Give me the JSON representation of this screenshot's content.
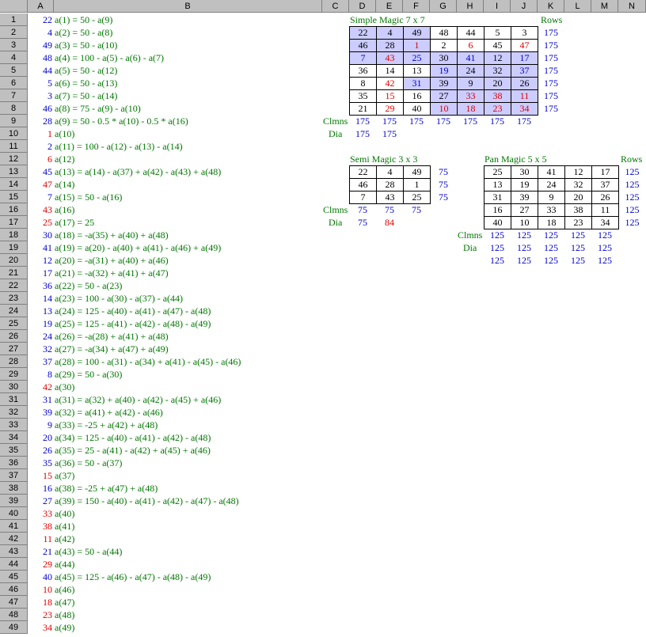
{
  "colors": {
    "blue": "#0000cc",
    "red": "#dd0000",
    "green": "#007700",
    "black": "#000000",
    "shade": "#ccccff"
  },
  "columns": [
    "A",
    "B",
    "C",
    "D",
    "E",
    "F",
    "G",
    "H",
    "I",
    "J",
    "K",
    "L",
    "M",
    "N"
  ],
  "rows": [
    "1",
    "2",
    "3",
    "4",
    "5",
    "6",
    "7",
    "8",
    "9",
    "10",
    "11",
    "12",
    "13",
    "14",
    "15",
    "16",
    "17",
    "18",
    "19",
    "20",
    "21",
    "22",
    "23",
    "24",
    "25",
    "26",
    "27",
    "28",
    "29",
    "30",
    "31",
    "32",
    "33",
    "34",
    "35",
    "36",
    "37",
    "38",
    "39",
    "40",
    "41",
    "42",
    "43",
    "44",
    "45",
    "46",
    "47",
    "48",
    "49"
  ],
  "colA": [
    {
      "v": "22",
      "c": "blue"
    },
    {
      "v": "4",
      "c": "blue"
    },
    {
      "v": "49",
      "c": "blue"
    },
    {
      "v": "48",
      "c": "blue"
    },
    {
      "v": "44",
      "c": "blue"
    },
    {
      "v": "5",
      "c": "blue"
    },
    {
      "v": "3",
      "c": "blue"
    },
    {
      "v": "46",
      "c": "blue"
    },
    {
      "v": "28",
      "c": "blue"
    },
    {
      "v": "1",
      "c": "red"
    },
    {
      "v": "2",
      "c": "blue"
    },
    {
      "v": "6",
      "c": "red"
    },
    {
      "v": "45",
      "c": "blue"
    },
    {
      "v": "47",
      "c": "red"
    },
    {
      "v": "7",
      "c": "blue"
    },
    {
      "v": "43",
      "c": "red"
    },
    {
      "v": "25",
      "c": "red"
    },
    {
      "v": "30",
      "c": "blue"
    },
    {
      "v": "41",
      "c": "blue"
    },
    {
      "v": "12",
      "c": "blue"
    },
    {
      "v": "17",
      "c": "blue"
    },
    {
      "v": "36",
      "c": "blue"
    },
    {
      "v": "14",
      "c": "blue"
    },
    {
      "v": "13",
      "c": "blue"
    },
    {
      "v": "19",
      "c": "blue"
    },
    {
      "v": "24",
      "c": "blue"
    },
    {
      "v": "32",
      "c": "blue"
    },
    {
      "v": "37",
      "c": "blue"
    },
    {
      "v": "8",
      "c": "blue"
    },
    {
      "v": "42",
      "c": "red"
    },
    {
      "v": "31",
      "c": "blue"
    },
    {
      "v": "39",
      "c": "blue"
    },
    {
      "v": "9",
      "c": "blue"
    },
    {
      "v": "20",
      "c": "blue"
    },
    {
      "v": "26",
      "c": "blue"
    },
    {
      "v": "35",
      "c": "blue"
    },
    {
      "v": "15",
      "c": "red"
    },
    {
      "v": "16",
      "c": "blue"
    },
    {
      "v": "27",
      "c": "blue"
    },
    {
      "v": "33",
      "c": "red"
    },
    {
      "v": "38",
      "c": "red"
    },
    {
      "v": "11",
      "c": "red"
    },
    {
      "v": "21",
      "c": "blue"
    },
    {
      "v": "29",
      "c": "red"
    },
    {
      "v": "40",
      "c": "blue"
    },
    {
      "v": "10",
      "c": "red"
    },
    {
      "v": "18",
      "c": "red"
    },
    {
      "v": "23",
      "c": "red"
    },
    {
      "v": "34",
      "c": "red"
    }
  ],
  "colB": [
    "a(1) = 50 - a(9)",
    "a(2) = 50 - a(8)",
    "a(3) = 50 - a(10)",
    "a(4) = 100 - a(5) - a(6) - a(7)",
    "a(5) = 50 - a(12)",
    "a(6) = 50 - a(13)",
    "a(7) = 50 - a(14)",
    "a(8) = 75 - a(9) - a(10)",
    "a(9) = 50 - 0.5 * a(10) - 0.5 * a(16)",
    "a(10)",
    "a(11) = 100 - a(12) - a(13) - a(14)",
    "a(12)",
    "a(13) = a(14) - a(37) + a(42) - a(43) + a(48)",
    "a(14)",
    "a(15) = 50 - a(16)",
    "a(16)",
    "a(17) = 25",
    "a(18) = -a(35) + a(40) + a(48)",
    "a(19) = a(20) - a(40) + a(41) - a(46) + a(49)",
    "a(20) = -a(31) + a(40) + a(46)",
    "a(21) = -a(32) + a(41) + a(47)",
    "a(22) = 50 - a(23)",
    "a(23) = 100 - a(30) - a(37) - a(44)",
    "a(24) = 125 - a(40) - a(41) - a(47) - a(48)",
    "a(25) = 125 - a(41) - a(42) - a(48) - a(49)",
    "a(26) = -a(28) + a(41) + a(48)",
    "a(27) = -a(34) + a(47) + a(49)",
    "a(28) = 100 - a(31) - a(34) + a(41) - a(45) - a(46)",
    "a(29) = 50 - a(30)",
    "a(30)",
    "a(31) = a(32) + a(40) - a(42) - a(45) + a(46)",
    "a(32) = a(41) + a(42) - a(46)",
    "a(33) = -25 + a(42) + a(48)",
    "a(34) = 125 - a(40) - a(41) - a(42) - a(48)",
    "a(35) = 25 - a(41) - a(42) + a(45) + a(46)",
    "a(36) = 50 - a(37)",
    "a(37)",
    "a(38) = -25 + a(47) + a(48)",
    "a(39) = 150 - a(40) - a(41) - a(42) - a(47) - a(48)",
    "a(40)",
    "a(41)",
    "a(42)",
    "a(43) = 50 - a(44)",
    "a(44)",
    "a(45) = 125 - a(46) - a(47) - a(48) - a(49)",
    "a(46)",
    "a(47)",
    "a(48)",
    "a(49)"
  ],
  "simple": {
    "title": "Simple Magic 7 x 7",
    "rows_label": "Rows",
    "grid": [
      [
        {
          "v": "22",
          "c": "black",
          "s": 1
        },
        {
          "v": "4",
          "c": "black",
          "s": 1
        },
        {
          "v": "49",
          "c": "black",
          "s": 1
        },
        {
          "v": "48",
          "c": "black",
          "s": 0
        },
        {
          "v": "44",
          "c": "black",
          "s": 0
        },
        {
          "v": "5",
          "c": "black",
          "s": 0
        },
        {
          "v": "3",
          "c": "black",
          "s": 0
        }
      ],
      [
        {
          "v": "46",
          "c": "black",
          "s": 1
        },
        {
          "v": "28",
          "c": "black",
          "s": 1
        },
        {
          "v": "1",
          "c": "red",
          "s": 1
        },
        {
          "v": "2",
          "c": "black",
          "s": 0
        },
        {
          "v": "6",
          "c": "red",
          "s": 0
        },
        {
          "v": "45",
          "c": "black",
          "s": 0
        },
        {
          "v": "47",
          "c": "red",
          "s": 0
        }
      ],
      [
        {
          "v": "7",
          "c": "blue",
          "s": 1
        },
        {
          "v": "43",
          "c": "red",
          "s": 1
        },
        {
          "v": "25",
          "c": "blue",
          "s": 1
        },
        {
          "v": "30",
          "c": "black",
          "s": 1
        },
        {
          "v": "41",
          "c": "blue",
          "s": 1
        },
        {
          "v": "12",
          "c": "black",
          "s": 1
        },
        {
          "v": "17",
          "c": "blue",
          "s": 1
        }
      ],
      [
        {
          "v": "36",
          "c": "black",
          "s": 0
        },
        {
          "v": "14",
          "c": "black",
          "s": 0
        },
        {
          "v": "13",
          "c": "black",
          "s": 0
        },
        {
          "v": "19",
          "c": "blue",
          "s": 1
        },
        {
          "v": "24",
          "c": "black",
          "s": 1
        },
        {
          "v": "32",
          "c": "black",
          "s": 1
        },
        {
          "v": "37",
          "c": "blue",
          "s": 1
        }
      ],
      [
        {
          "v": "8",
          "c": "black",
          "s": 0
        },
        {
          "v": "42",
          "c": "red",
          "s": 0
        },
        {
          "v": "31",
          "c": "blue",
          "s": 1
        },
        {
          "v": "39",
          "c": "black",
          "s": 1
        },
        {
          "v": "9",
          "c": "black",
          "s": 1
        },
        {
          "v": "20",
          "c": "black",
          "s": 1
        },
        {
          "v": "26",
          "c": "black",
          "s": 1
        }
      ],
      [
        {
          "v": "35",
          "c": "black",
          "s": 0
        },
        {
          "v": "15",
          "c": "red",
          "s": 0
        },
        {
          "v": "16",
          "c": "black",
          "s": 0
        },
        {
          "v": "27",
          "c": "black",
          "s": 1
        },
        {
          "v": "33",
          "c": "red",
          "s": 1
        },
        {
          "v": "38",
          "c": "red",
          "s": 1
        },
        {
          "v": "11",
          "c": "red",
          "s": 1
        }
      ],
      [
        {
          "v": "21",
          "c": "black",
          "s": 0
        },
        {
          "v": "29",
          "c": "red",
          "s": 0
        },
        {
          "v": "40",
          "c": "black",
          "s": 0
        },
        {
          "v": "10",
          "c": "red",
          "s": 1
        },
        {
          "v": "18",
          "c": "red",
          "s": 1
        },
        {
          "v": "23",
          "c": "red",
          "s": 1
        },
        {
          "v": "34",
          "c": "red",
          "s": 1
        }
      ]
    ],
    "row_sums": [
      "175",
      "175",
      "175",
      "175",
      "175",
      "175",
      "175"
    ],
    "col_label": "Clmns",
    "col_sums": [
      "175",
      "175",
      "175",
      "175",
      "175",
      "175",
      "175"
    ],
    "dia_label": "Dia",
    "dia_sums": [
      "175",
      "175"
    ]
  },
  "semi": {
    "title": "Semi Magic 3 x 3",
    "grid": [
      [
        "22",
        "4",
        "49"
      ],
      [
        "46",
        "28",
        "1"
      ],
      [
        "7",
        "43",
        "25"
      ]
    ],
    "row_sums": [
      "75",
      "75",
      "75"
    ],
    "col_label": "Clmns",
    "col_sums": [
      "75",
      "75",
      "75"
    ],
    "dia_label": "Dia",
    "dia_sums": [
      {
        "v": "75",
        "c": "blue"
      },
      {
        "v": "84",
        "c": "red"
      }
    ]
  },
  "pan": {
    "title": "Pan Magic 5 x 5",
    "rows_label": "Rows",
    "grid": [
      [
        "25",
        "30",
        "41",
        "12",
        "17"
      ],
      [
        "13",
        "19",
        "24",
        "32",
        "37"
      ],
      [
        "31",
        "39",
        "9",
        "20",
        "26"
      ],
      [
        "16",
        "27",
        "33",
        "38",
        "11"
      ],
      [
        "40",
        "10",
        "18",
        "23",
        "34"
      ]
    ],
    "row_sums": [
      "125",
      "125",
      "125",
      "125",
      "125"
    ],
    "col_label": "Clmns",
    "col_sums": [
      "125",
      "125",
      "125",
      "125",
      "125"
    ],
    "dia_label": "Dia",
    "dia_sums1": [
      "125",
      "125",
      "125",
      "125",
      "125"
    ],
    "dia_sums2": [
      "125",
      "125",
      "125",
      "125",
      "125"
    ]
  }
}
